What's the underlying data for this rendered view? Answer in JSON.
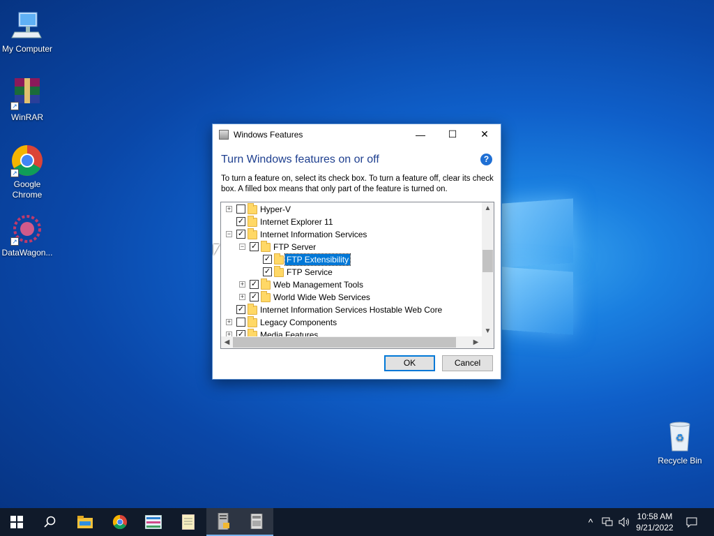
{
  "desktop": {
    "icons": [
      {
        "label": "My Computer",
        "icon": "computer-icon"
      },
      {
        "label": "WinRAR",
        "icon": "winrar-icon"
      },
      {
        "label": "Google\nChrome",
        "icon": "chrome-icon"
      },
      {
        "label": "DataWagon...",
        "icon": "datawagon-icon"
      },
      {
        "label": "Recycle Bin",
        "icon": "recycle-bin-icon"
      }
    ]
  },
  "window": {
    "title": "Windows Features",
    "heading": "Turn Windows features on or off",
    "description": "To turn a feature on, select its check box. To turn a feature off, clear its check box. A filled box means that only part of the feature is turned on.",
    "features": [
      {
        "label": "Hyper-V",
        "level": 0,
        "expander": "+",
        "checked": false
      },
      {
        "label": "Internet Explorer 11",
        "level": 0,
        "expander": "",
        "checked": true
      },
      {
        "label": "Internet Information Services",
        "level": 0,
        "expander": "−",
        "checked": true
      },
      {
        "label": "FTP Server",
        "level": 1,
        "expander": "−",
        "checked": true
      },
      {
        "label": "FTP Extensibility",
        "level": 2,
        "expander": "",
        "checked": true,
        "selected": true
      },
      {
        "label": "FTP Service",
        "level": 2,
        "expander": "",
        "checked": true
      },
      {
        "label": "Web Management Tools",
        "level": 1,
        "expander": "+",
        "checked": true
      },
      {
        "label": "World Wide Web Services",
        "level": 1,
        "expander": "+",
        "checked": true
      },
      {
        "label": "Internet Information Services Hostable Web Core",
        "level": 0,
        "expander": "",
        "checked": true
      },
      {
        "label": "Legacy Components",
        "level": 0,
        "expander": "+",
        "checked": false
      },
      {
        "label": "Media Features",
        "level": 0,
        "expander": "+",
        "checked": true
      }
    ],
    "ok_label": "OK",
    "cancel_label": "Cancel",
    "minimize_glyph": "—",
    "maximize_glyph": "☐",
    "close_glyph": "✕",
    "help_glyph": "?"
  },
  "taskbar": {
    "items": [
      "start-icon",
      "search-icon",
      "file-explorer-icon",
      "chrome-icon",
      "control-panel-icon",
      "notepad-icon",
      "server-manager-icon",
      "windows-features-icon"
    ],
    "clock_time": "10:58 AM",
    "clock_date": "9/21/2022"
  }
}
